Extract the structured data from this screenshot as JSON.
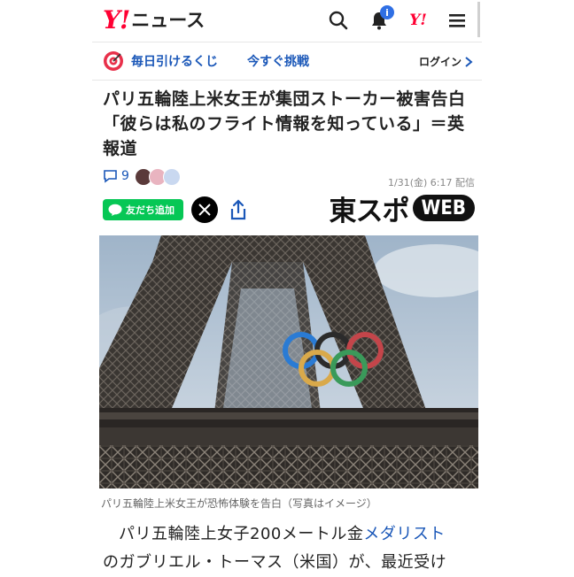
{
  "header": {
    "logo_y": "Y!",
    "logo_text": "ニュース",
    "notification_count": "i",
    "yahoo_mini": "Y!"
  },
  "promo": {
    "label1": "毎日引けるくじ",
    "label2": "今すぐ挑戦",
    "login": "ログイン"
  },
  "article": {
    "title": "パリ五輪陸上米女王が集団ストーカー被害告白「彼らは私のフライト情報を知っている」＝英報道",
    "comment_count": "9",
    "date": "1/31(金) 6:17 配信",
    "line_button": "友だち追加",
    "brand": "東スポ",
    "brand_badge": "WEB",
    "caption": "パリ五輪陸上米女王が恐怖体験を告白（写真はイメージ）",
    "body_line1_a": "パリ五輪陸上女子200メートル金",
    "body_line1_link": "メダリスト",
    "body_line2": "のガブリエル・トーマス（米国）が、最近受け"
  },
  "colors": {
    "accent_blue": "#1a57b8",
    "yahoo_red": "#ff0033",
    "line_green": "#06c755"
  }
}
